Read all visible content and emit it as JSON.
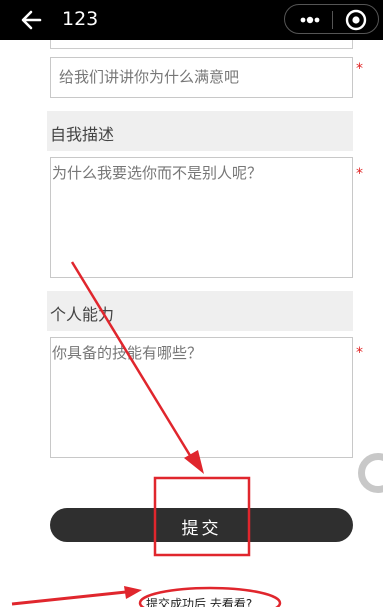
{
  "header": {
    "title": "123",
    "back_icon": "back-arrow-icon",
    "more_icon": "more-dots-icon",
    "close_icon": "close-circle-icon"
  },
  "form": {
    "satisfaction": {
      "placeholder": "给我们讲讲你为什么满意吧"
    },
    "self_description": {
      "label": "自我描述",
      "placeholder": "为什么我要选你而不是别人呢？"
    },
    "ability": {
      "label": "个人能力",
      "placeholder": "你具备的技能有哪些？"
    },
    "required_mark": "*"
  },
  "submit": {
    "label": "提交"
  },
  "after_submit_link": "提交成功后 去看看?",
  "colors": {
    "annotation": "#e0262d",
    "header_bg": "#000000",
    "button_bg": "#2f2f2f"
  }
}
